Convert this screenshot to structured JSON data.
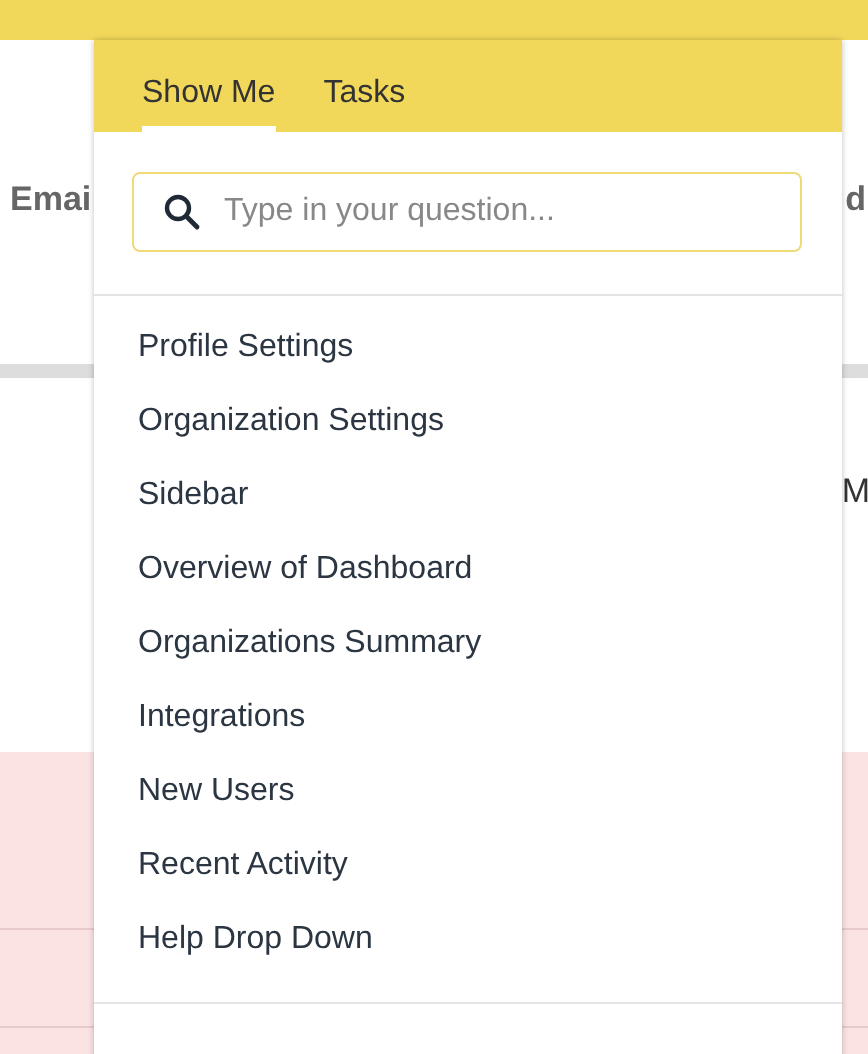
{
  "background_page": {
    "texts": [
      {
        "text": "Emai",
        "kind": "heading-left"
      },
      {
        "text": "d",
        "kind": "heading-right"
      },
      {
        "text": "M",
        "kind": "label-right"
      }
    ]
  },
  "help_panel": {
    "tabs": [
      {
        "label": "Show Me",
        "selected": true
      },
      {
        "label": "Tasks",
        "selected": false
      }
    ],
    "search": {
      "placeholder": "Type in your question..."
    },
    "items": [
      "Profile Settings",
      "Organization Settings",
      "Sidebar",
      "Overview of Dashboard",
      "Organizations Summary",
      "Integrations",
      "New Users",
      "Recent Activity",
      "Help Drop Down"
    ]
  }
}
